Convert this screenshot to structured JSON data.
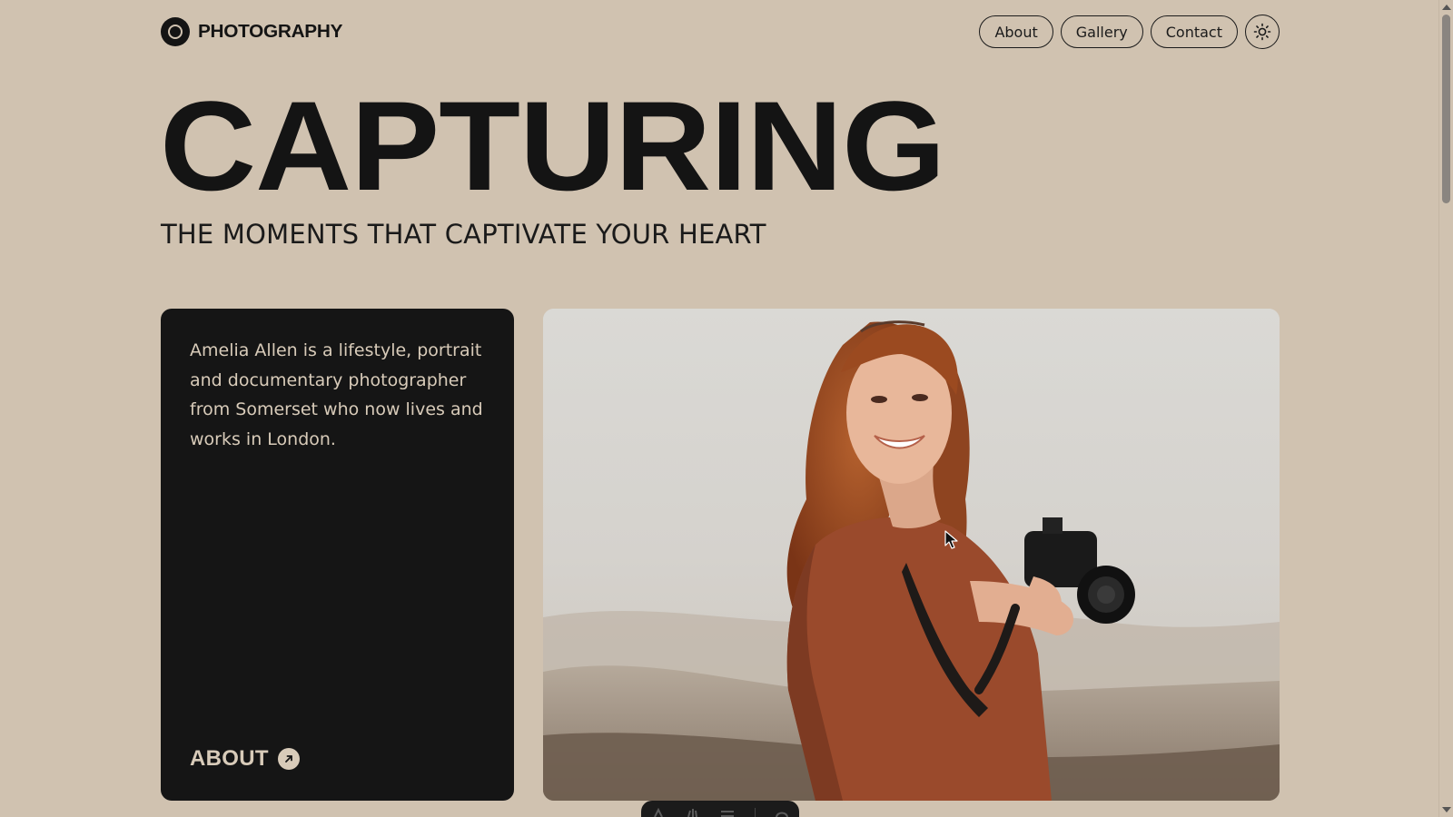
{
  "header": {
    "brand_name": "PHOTOGRAPHY",
    "brand_logo_icon": "circle-logo-icon",
    "nav": [
      {
        "label": "About"
      },
      {
        "label": "Gallery"
      },
      {
        "label": "Contact"
      }
    ],
    "theme_toggle_icon": "sun-icon"
  },
  "hero": {
    "title": "CAPTURING",
    "subtitle": "THE MOMENTS THAT CAPTIVATE YOUR HEART"
  },
  "about_card": {
    "text": "Amelia Allen is a lifestyle, portrait and documentary photographer from Somerset who now lives and works in London.",
    "link_label": "ABOUT",
    "link_icon": "arrow-up-right-icon"
  },
  "photo": {
    "subject": "woman-with-camera-photo"
  },
  "colors": {
    "background": "#d0c2b0",
    "dark": "#151515",
    "card_text": "#d8cbb9"
  }
}
